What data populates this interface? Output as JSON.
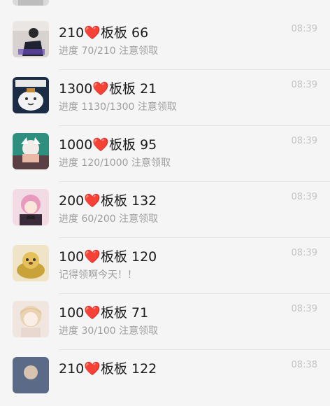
{
  "chats": [
    {
      "title_prefix": "210",
      "heart": "❤️",
      "title_suffix": "板板 66",
      "preview": "进度 70/210 注意领取",
      "time": "08:39",
      "avatar_icon": "girl-sitting-avatar"
    },
    {
      "title_prefix": "1300",
      "heart": "❤️",
      "title_suffix": "板板 21",
      "preview": "进度 1130/1300 注意领取",
      "time": "08:39",
      "avatar_icon": "cartoon-meme-avatar"
    },
    {
      "title_prefix": "1000",
      "heart": "❤️",
      "title_suffix": "板板 95",
      "preview": "进度 120/1000 注意领取",
      "time": "08:39",
      "avatar_icon": "anime-white-hair-avatar"
    },
    {
      "title_prefix": "200",
      "heart": "❤️",
      "title_suffix": "板板 132",
      "preview": "进度 60/200 注意领取",
      "time": "08:39",
      "avatar_icon": "anime-pink-hair-avatar"
    },
    {
      "title_prefix": "100",
      "heart": "❤️",
      "title_suffix": "板板 120",
      "preview": "记得领啊今天！！",
      "time": "08:39",
      "avatar_icon": "pudding-dog-avatar"
    },
    {
      "title_prefix": "100",
      "heart": "❤️",
      "title_suffix": "板板 71",
      "preview": "进度 30/100 注意领取",
      "time": "08:39",
      "avatar_icon": "anime-blonde-avatar"
    },
    {
      "title_prefix": "210",
      "heart": "❤️",
      "title_suffix": "板板 122",
      "preview": "",
      "time": "08:38",
      "avatar_icon": "partial-avatar"
    }
  ]
}
